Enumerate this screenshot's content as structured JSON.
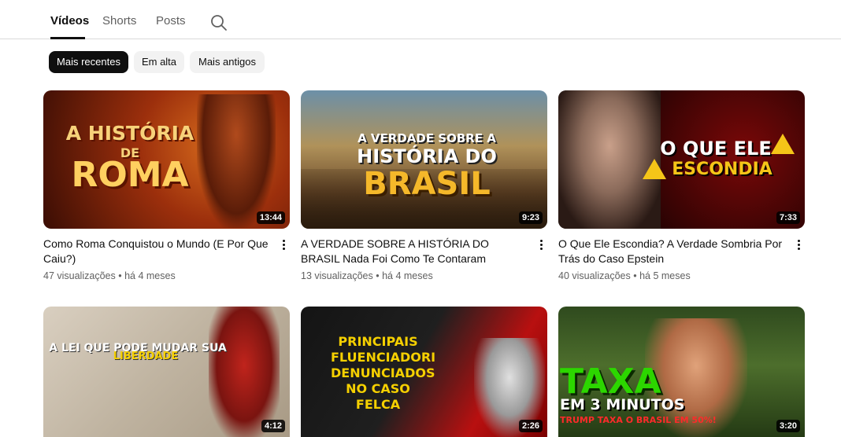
{
  "tabs": [
    {
      "label": "Vídeos"
    },
    {
      "label": "Shorts"
    },
    {
      "label": "Posts"
    }
  ],
  "chips": [
    {
      "label": "Mais recentes"
    },
    {
      "label": "Em alta"
    },
    {
      "label": "Mais antigos"
    }
  ],
  "videos": [
    {
      "title": "Como Roma Conquistou o Mundo (E Por Que Caiu?)",
      "views": "47 visualizações",
      "age": "há 4 meses",
      "duration": "13:44",
      "thumb_line1": "A HISTÓRIA",
      "thumb_line2": "DE",
      "thumb_line3": "ROMA"
    },
    {
      "title": "A VERDADE SOBRE A HISTÓRIA DO BRASIL Nada Foi Como Te Contaram",
      "views": "13 visualizações",
      "age": "há 4 meses",
      "duration": "9:23",
      "thumb_line1": "A VERDADE SOBRE A",
      "thumb_line2": "HISTÓRIA DO",
      "thumb_line3": "BRASIL"
    },
    {
      "title": "O Que Ele Escondia? A Verdade Sombria Por Trás do Caso Epstein",
      "views": "40 visualizações",
      "age": "há 5 meses",
      "duration": "7:33",
      "thumb_line1": "O QUE ELE",
      "thumb_line2": "ESCONDIA"
    },
    {
      "duration": "4:12",
      "thumb_line1": "A LEI QUE PODE MUDAR SUA",
      "thumb_line2": "LIBERDADE"
    },
    {
      "duration": "2:26",
      "thumb_line1": "PRINCIPAIS",
      "thumb_line2": "FLUENCIADORI",
      "thumb_line3": "DENUNCIADOS",
      "thumb_line4": "NO CASO",
      "thumb_line5": "FELCA"
    },
    {
      "duration": "3:20",
      "thumb_line1": "TAXA",
      "thumb_line2": "EM 3 MINUTOS",
      "thumb_line3": "TRUMP TAXA O BRASIL EM 50%!"
    }
  ],
  "meta_separator": "•",
  "colors": {
    "selected_chip": "#0f0f0f",
    "chip": "#f2f2f2",
    "meta_text": "#606060"
  }
}
